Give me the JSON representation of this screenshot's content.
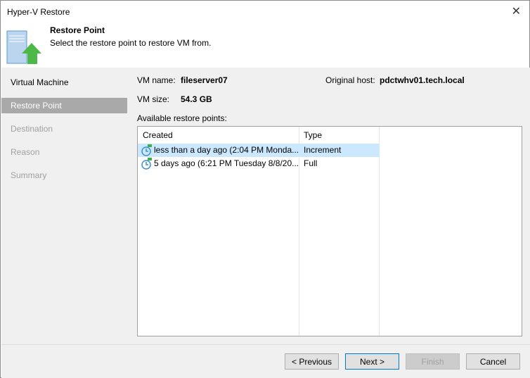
{
  "window": {
    "title": "Hyper-V Restore"
  },
  "header": {
    "title": "Restore Point",
    "subtitle": "Select the restore point to restore VM from."
  },
  "sidebar": {
    "items": [
      {
        "label": "Virtual Machine",
        "state": "done"
      },
      {
        "label": "Restore Point",
        "state": "selected"
      },
      {
        "label": "Destination",
        "state": "pending"
      },
      {
        "label": "Reason",
        "state": "pending"
      },
      {
        "label": "Summary",
        "state": "pending"
      }
    ]
  },
  "main": {
    "vm_name_label": "VM name:",
    "vm_name": "fileserver07",
    "orig_host_label": "Original host:",
    "orig_host": "pdctwhv01.tech.local",
    "vm_size_label": "VM size:",
    "vm_size": "54.3 GB",
    "list_label": "Available restore points:",
    "columns": [
      "Created",
      "Type"
    ],
    "rows": [
      {
        "created": "less than a day ago (2:04 PM Monda...",
        "type": "Increment",
        "selected": true
      },
      {
        "created": "5 days ago (6:21 PM Tuesday 8/8/20...",
        "type": "Full",
        "selected": false
      }
    ]
  },
  "footer": {
    "previous": "< Previous",
    "next": "Next >",
    "finish": "Finish",
    "cancel": "Cancel"
  },
  "colors": {
    "selection": "#cce8ff",
    "sidebar_selected": "#a9a9a9",
    "accent": "#0078d7"
  }
}
